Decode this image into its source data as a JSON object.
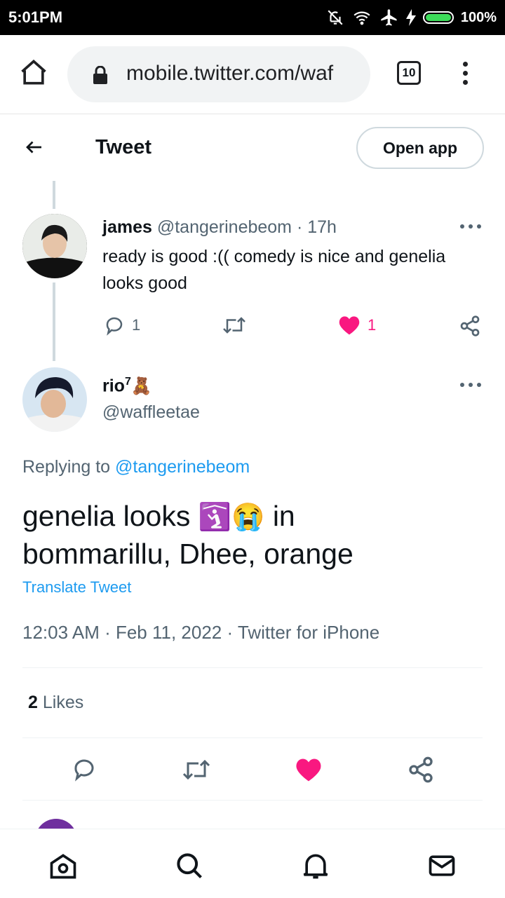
{
  "status_bar": {
    "time": "5:01PM",
    "battery_percent": "100%",
    "icons": [
      "bell-off-icon",
      "wifi-icon",
      "airplane-icon",
      "charging-icon",
      "battery-icon"
    ]
  },
  "browser": {
    "url": "mobile.twitter.com/waf",
    "tab_count": "10"
  },
  "header": {
    "title": "Tweet",
    "open_app_label": "Open app"
  },
  "parent_tweet": {
    "display_name": "james",
    "handle": "@tangerinebeom",
    "time_ago": "· 17h",
    "text_line1": "ready is good :(( comedy is nice and genelia",
    "text_line2": "looks good",
    "reply_count": "1",
    "like_count": "1"
  },
  "main_tweet": {
    "display_name": "rio",
    "name_superscript": "7",
    "name_emoji": "🧸",
    "handle": "@waffleetae",
    "replying_prefix": "Replying to",
    "replying_handle": "@tangerinebeom",
    "text_line1_start": "genelia looks",
    "emoji_one": "🛐",
    "emoji_two": "😭",
    "text_line1_end": "in",
    "text_line2": "bommarillu, Dhee, orange",
    "translate_label": "Translate Tweet",
    "timestamp": "12:03 AM · Feb 11, 2022 · Twitter for iPhone",
    "likes_count": "2",
    "likes_label": "Likes"
  },
  "colors": {
    "link": "#1d9bf0",
    "like": "#f91880",
    "muted": "#536471"
  }
}
